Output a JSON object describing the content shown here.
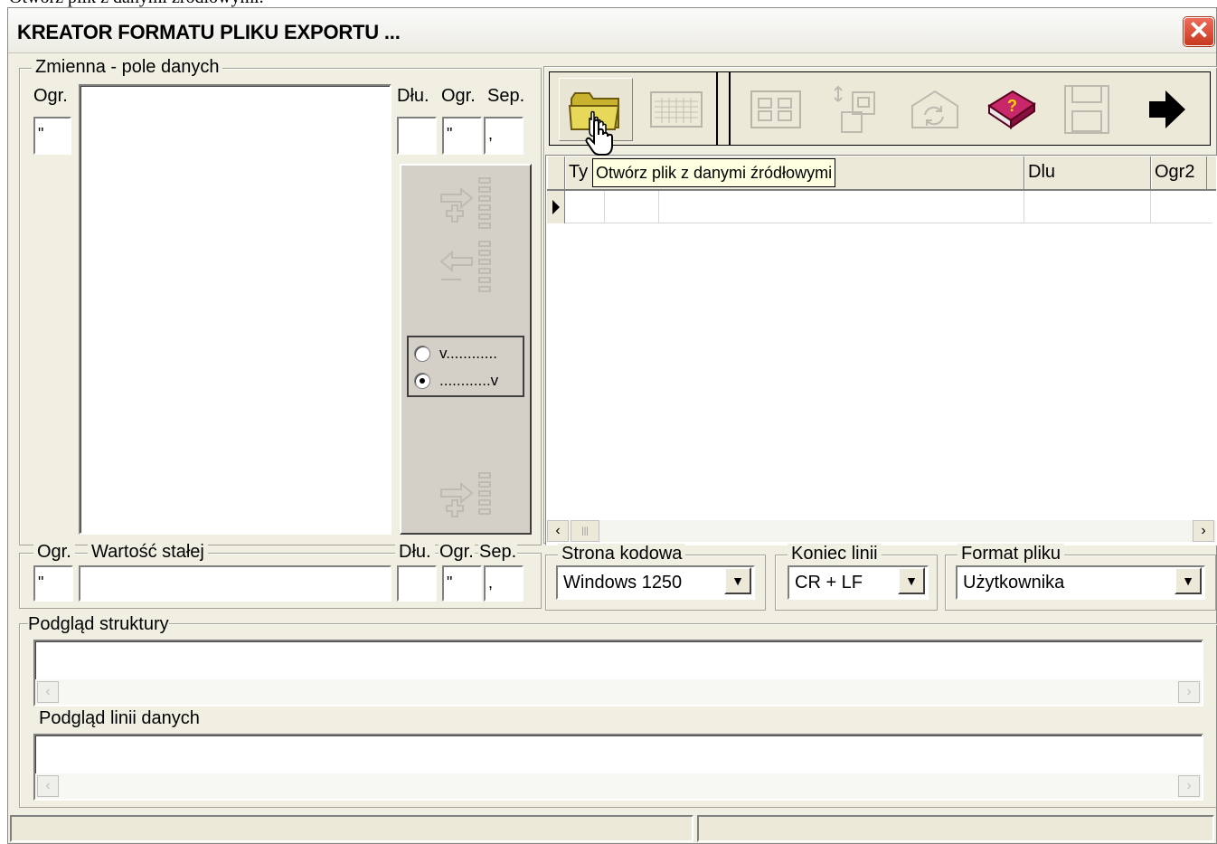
{
  "caption": "Otwórz plik z danymi źródłowymi.",
  "window": {
    "title": "KREATOR FORMATU PLIKU EXPORTU ...",
    "close_label": "✕"
  },
  "variable_group": {
    "legend": "Zmienna - pole danych",
    "ogr_label": "Ogr.",
    "ogr_value": "\"",
    "dlu_label": "Dłu.",
    "ogr2_label": "Ogr.",
    "sep_label": "Sep.",
    "dlu_value": "",
    "ogr2_value": "\"",
    "sep_value": ","
  },
  "radio_options": [
    {
      "label": "v............",
      "selected": false
    },
    {
      "label": "............v",
      "selected": true
    }
  ],
  "constant_group": {
    "ogr_label": "Ogr.",
    "legend": "Wartość stałej",
    "dlu_label": "Dłu.",
    "ogr2_label": "Ogr.",
    "sep_label": "Sep.",
    "ogr_value": "\"",
    "value": "",
    "dlu_value": "",
    "ogr2_value": "\"",
    "sep_value": ","
  },
  "toolbar": {
    "buttons": [
      "open-folder-icon",
      "grid-icon",
      "columns-icon",
      "transfer-icon",
      "refresh-icon",
      "help-book-icon",
      "save-disk-icon",
      "next-arrow-icon"
    ]
  },
  "tooltip": "Otwórz plik  z danymi źródłowymi",
  "grid": {
    "columns": [
      "Ty",
      "",
      "Dlu",
      "Ogr2"
    ],
    "rows": 1
  },
  "codepage": {
    "legend": "Strona kodowa",
    "value": "Windows 1250"
  },
  "line_end": {
    "legend": "Koniec linii",
    "value": "CR + LF"
  },
  "file_format": {
    "legend": "Format pliku",
    "value": "Użytkownika"
  },
  "preview": {
    "structure_label": "Podgląd struktury",
    "data_line_label": "Podgląd linii danych"
  },
  "colors": {
    "toolbar_bg": "#ece9d8",
    "tooltip_bg": "#ffffe1",
    "panel_bg": "#f1efe2"
  }
}
